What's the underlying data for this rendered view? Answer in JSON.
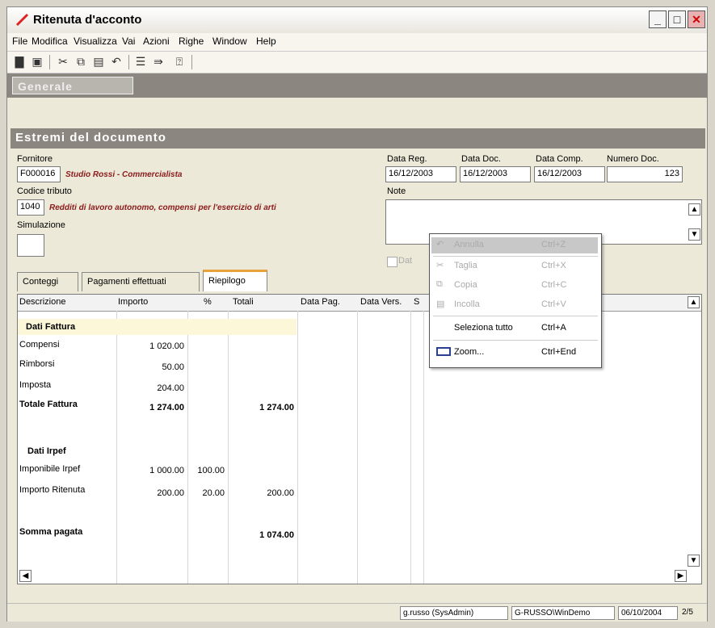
{
  "window": {
    "title": "Ritenuta d'acconto"
  },
  "menu": [
    "File",
    "Modifica",
    "Visualizza",
    "Vai",
    "Azioni",
    "Righe",
    "Window",
    "Help"
  ],
  "bands": {
    "first": "Generale",
    "second": "Estremi del documento"
  },
  "header": {
    "fornitore_label": "Fornitore",
    "fornitore_code": "F000016",
    "fornitore_name": "Studio Rossi - Commercialista",
    "codice_tributo_label": "Codice tributo",
    "codice_tributo_code": "1040",
    "codice_tributo_desc": "Redditi di lavoro autonomo, compensi per l'esercizio di arti",
    "simulazione_label": "Simulazione",
    "data_reg_label": "Data Reg.",
    "data_reg": "16/12/2003",
    "data_doc_label": "Data Doc.",
    "data_doc": "16/12/2003",
    "data_comp_label": "Data Comp.",
    "data_comp": "16/12/2003",
    "numero_doc_label": "Numero Doc.",
    "numero_doc": "123",
    "note_label": "Note",
    "checkbox_label": "Dat"
  },
  "tabs": [
    "Conteggi",
    "Pagamenti effettuati",
    "Riepilogo"
  ],
  "table": {
    "headers": [
      "Descrizione",
      "Importo",
      "%",
      "Totali",
      "Data Pag.",
      "Data Vers.",
      "S"
    ],
    "section1": "Dati Fattura",
    "rows1": [
      {
        "desc": "Compensi",
        "importo": "1 020.00",
        "perc": "",
        "tot": ""
      },
      {
        "desc": "Rimborsi",
        "importo": "50.00",
        "perc": "",
        "tot": ""
      },
      {
        "desc": "Imposta",
        "importo": "204.00",
        "perc": "",
        "tot": ""
      }
    ],
    "totale_fattura": {
      "desc": "Totale Fattura",
      "importo": "1 274.00",
      "tot": "1 274.00"
    },
    "section2": "Dati Irpef",
    "rows2": [
      {
        "desc": "Imponibile Irpef",
        "importo": "1 000.00",
        "perc": "100.00",
        "tot": ""
      },
      {
        "desc": "Importo Ritenuta",
        "importo": "200.00",
        "perc": "20.00",
        "tot": "200.00"
      }
    ],
    "somma": {
      "desc": "Somma pagata",
      "tot": "1 074.00"
    }
  },
  "context_menu": {
    "items": [
      {
        "label": "Annulla",
        "shortcut": "Ctrl+Z",
        "disabled": true
      },
      {
        "label": "Taglia",
        "shortcut": "Ctrl+X",
        "disabled": true
      },
      {
        "label": "Copia",
        "shortcut": "Ctrl+C",
        "disabled": true
      },
      {
        "label": "Incolla",
        "shortcut": "Ctrl+V",
        "disabled": true
      },
      {
        "label": "Seleziona tutto",
        "shortcut": "Ctrl+A",
        "disabled": false
      },
      {
        "label": "Zoom...",
        "shortcut": "Ctrl+End",
        "disabled": false
      }
    ]
  },
  "status": {
    "user": "g.russo (SysAdmin)",
    "machine": "G-RUSSO\\WinDemo",
    "date": "06/10/2004",
    "page": "2/5"
  }
}
